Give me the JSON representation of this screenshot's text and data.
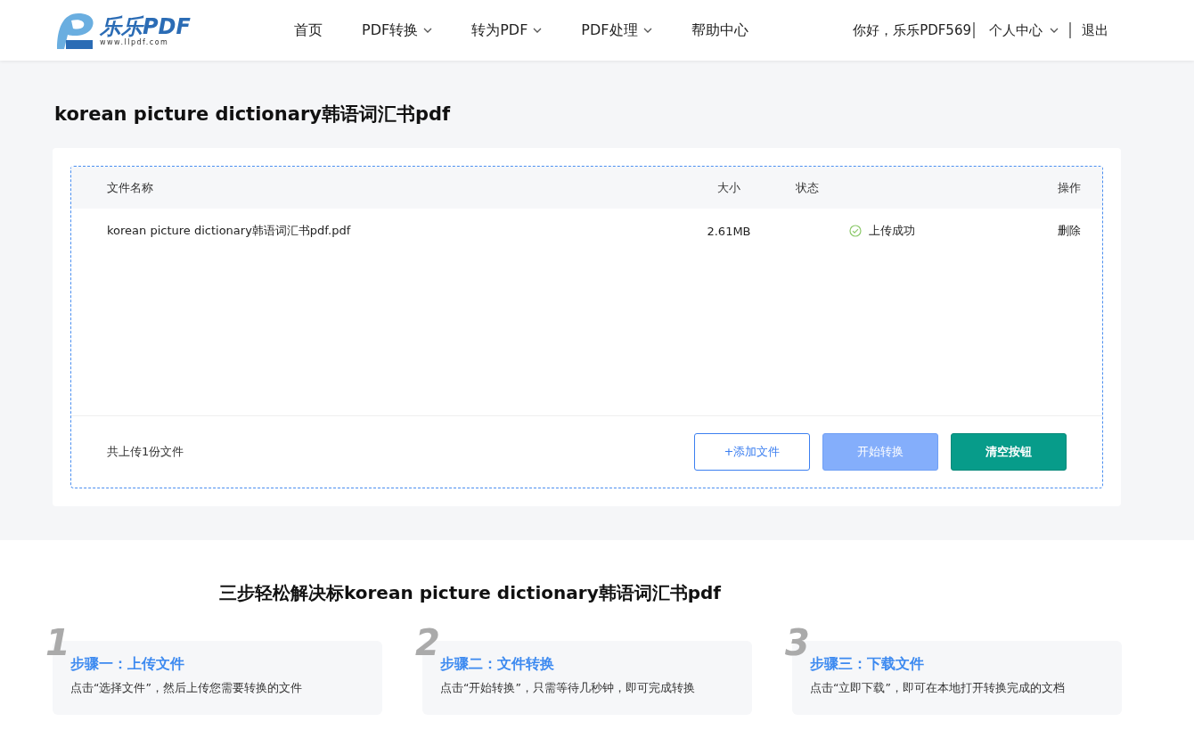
{
  "header": {
    "logo": {
      "name": "乐乐PDF",
      "url": "www.llpdf.com"
    },
    "nav": [
      {
        "label": "首页",
        "dropdown": false
      },
      {
        "label": "PDF转换",
        "dropdown": true
      },
      {
        "label": "转为PDF",
        "dropdown": true
      },
      {
        "label": "PDF处理",
        "dropdown": true
      },
      {
        "label": "帮助中心",
        "dropdown": false
      }
    ],
    "greeting": "你好，乐乐PDF569",
    "user_menu": "个人中心",
    "logout": "退出"
  },
  "page_title": "korean picture dictionary韩语词汇书pdf",
  "table": {
    "columns": [
      "文件名称",
      "大小",
      "状态",
      "操作"
    ],
    "rows": [
      {
        "name": "korean picture dictionary韩语词汇书pdf.pdf",
        "size": "2.61MB",
        "status": "上传成功",
        "action": "删除"
      }
    ]
  },
  "summary": "共上传1份文件",
  "buttons": [
    {
      "label": "+添加文件",
      "kind": "outline"
    },
    {
      "label": "开始转换",
      "kind": "disabled"
    },
    {
      "label": "清空按钮",
      "kind": "primary"
    }
  ],
  "steps_title": "三步轻松解决标korean picture dictionary韩语词汇书pdf",
  "steps": [
    {
      "number": "1",
      "title": "步骤一：上传文件",
      "text": "点击“选择文件”，然后上传您需要转换的文件"
    },
    {
      "number": "2",
      "title": "步骤二：文件转换",
      "text": "点击“开始转换”，只需等待几秒钟，即可完成转换"
    },
    {
      "number": "3",
      "title": "步骤三：下载文件",
      "text": "点击“立即下载”，即可在本地打开转换完成的文档"
    }
  ]
}
